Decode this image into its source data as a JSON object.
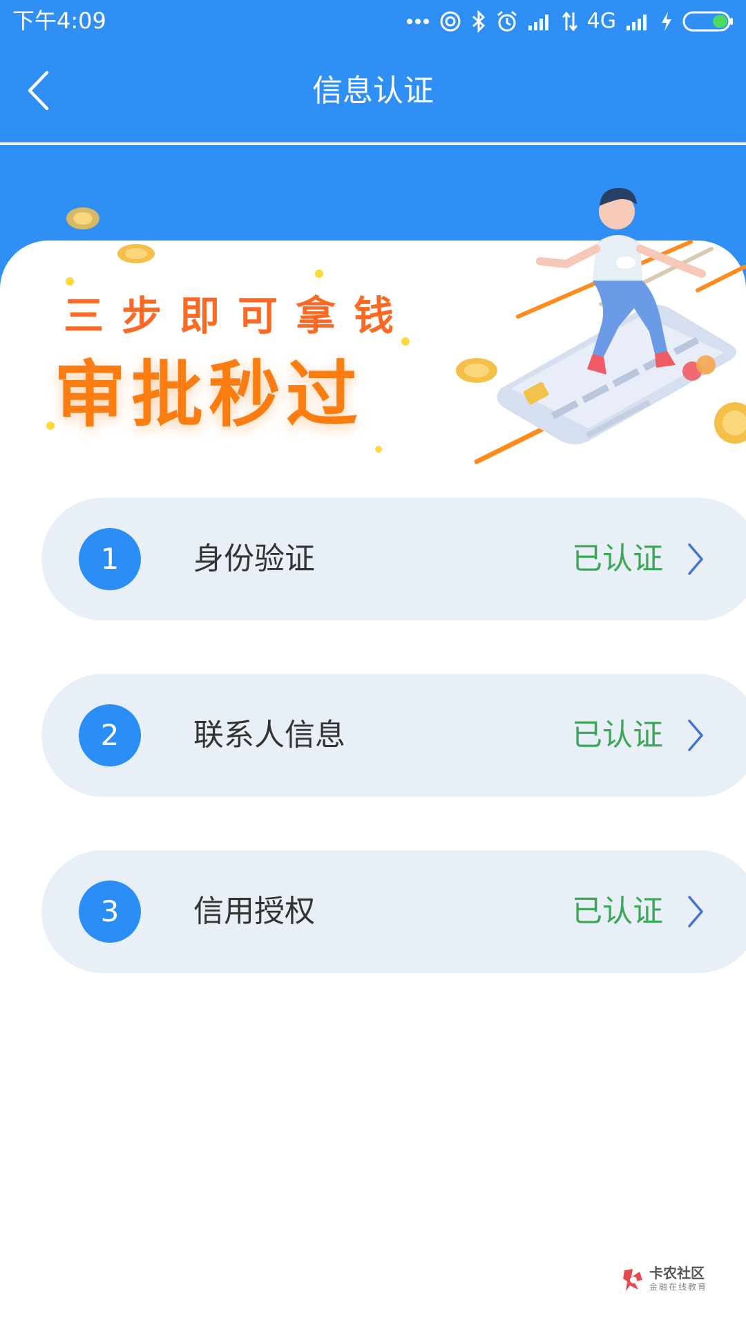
{
  "status_bar": {
    "time": "下午4:09",
    "network": "4G",
    "icons": [
      "more-dots-icon",
      "hotspot-icon",
      "bluetooth-icon",
      "alarm-icon",
      "signal-icon",
      "data-arrows-icon",
      "signal-icon",
      "charging-icon",
      "battery-icon"
    ]
  },
  "header": {
    "title": "信息认证",
    "back_icon": "back-arrow-icon"
  },
  "banner": {
    "subtitle": "三步即可拿钱",
    "title": "审批秒过"
  },
  "steps": [
    {
      "number": "1",
      "label": "身份验证",
      "status": "已认证"
    },
    {
      "number": "2",
      "label": "联系人信息",
      "status": "已认证"
    },
    {
      "number": "3",
      "label": "信用授权",
      "status": "已认证"
    }
  ],
  "watermark": {
    "name": "卡农社区",
    "tagline": "金融在线教育"
  },
  "colors": {
    "primary": "#2f8ff5",
    "status_ok": "#3aa857",
    "step_bg": "#e9eff7",
    "banner_orange": "#fb7d12"
  }
}
